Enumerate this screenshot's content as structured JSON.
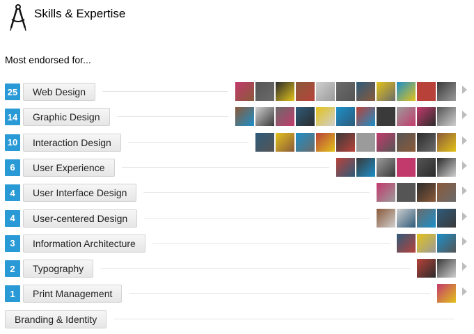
{
  "header": {
    "title": "Skills & Expertise",
    "icon": "drafting-compass-icon"
  },
  "subtitle": "Most endorsed for...",
  "avatar_palette": [
    "#c23a6b",
    "#555555",
    "#2b2b2b",
    "#8a5a3a",
    "#cfcfcf",
    "#6b6b6b",
    "#2e5b7a",
    "#e3c21a",
    "#1c8fc8",
    "#b8423a",
    "#3a3a3a",
    "#9b9b9b"
  ],
  "skills": [
    {
      "name": "Web Design",
      "count": "25",
      "avatars": 11
    },
    {
      "name": "Graphic Design",
      "count": "14",
      "avatars": 11
    },
    {
      "name": "Interaction Design",
      "count": "10",
      "avatars": 10
    },
    {
      "name": "User Experience",
      "count": "6",
      "avatars": 6
    },
    {
      "name": "User Interface Design",
      "count": "4",
      "avatars": 4
    },
    {
      "name": "User-centered Design",
      "count": "4",
      "avatars": 4
    },
    {
      "name": "Information Architecture",
      "count": "3",
      "avatars": 3
    },
    {
      "name": "Typography",
      "count": "2",
      "avatars": 2
    },
    {
      "name": "Print Management",
      "count": "1",
      "avatars": 1
    },
    {
      "name": "Branding & Identity",
      "count": "",
      "avatars": 0
    }
  ]
}
